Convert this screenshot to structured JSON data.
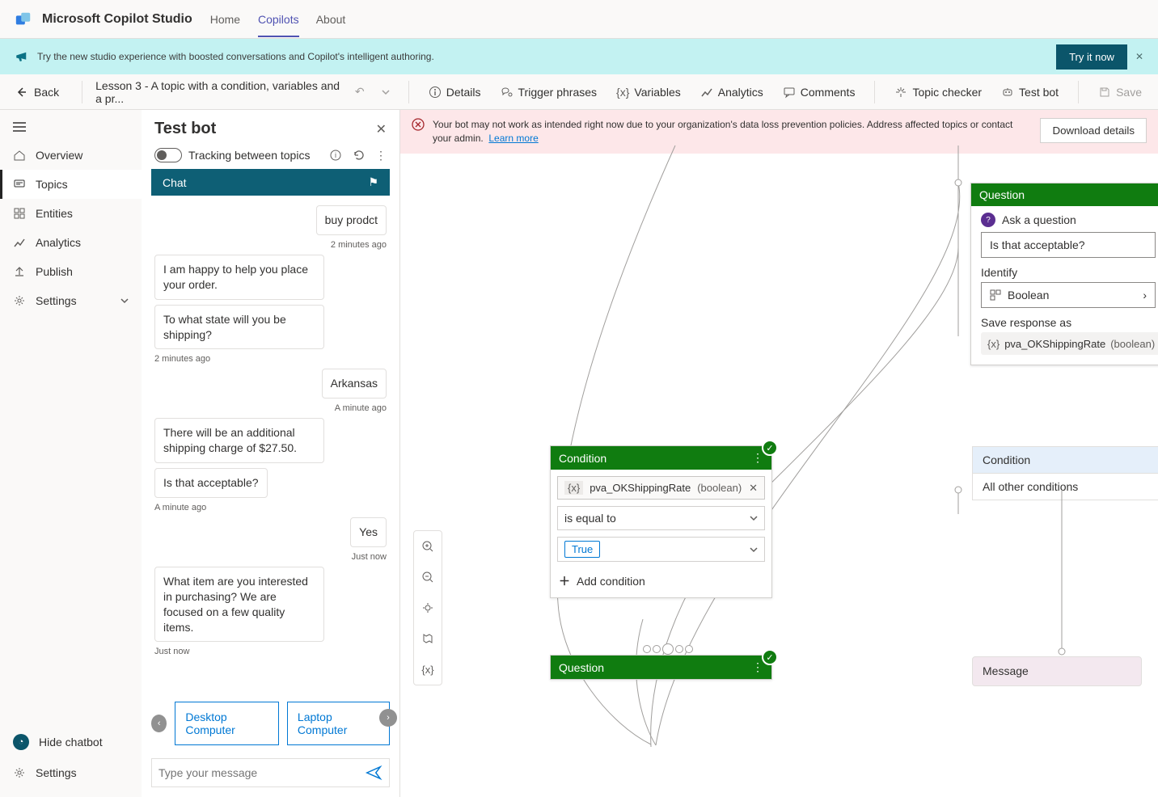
{
  "brand": "Microsoft Copilot Studio",
  "nav": {
    "home": "Home",
    "copilots": "Copilots",
    "about": "About"
  },
  "banner": {
    "text": "Try the new studio experience with boosted conversations and Copilot's intelligent authoring.",
    "try": "Try it now"
  },
  "toolbar": {
    "back": "Back",
    "breadcrumb": "Lesson 3 - A topic with a condition, variables and a pr...",
    "details": "Details",
    "trigger": "Trigger phrases",
    "variables": "Variables",
    "analytics": "Analytics",
    "comments": "Comments",
    "topic_checker": "Topic checker",
    "test_bot": "Test bot",
    "save": "Save"
  },
  "rail": {
    "overview": "Overview",
    "topics": "Topics",
    "entities": "Entities",
    "analytics": "Analytics",
    "publish": "Publish",
    "settings": "Settings",
    "hide": "Hide chatbot",
    "settings2": "Settings"
  },
  "testbot": {
    "title": "Test bot",
    "tracking": "Tracking between topics",
    "chat": "Chat",
    "m1": "buy prodct",
    "t1": "2 minutes ago",
    "m2": "I am happy to help you place your order.",
    "m3": "To what state will you be shipping?",
    "t2": "2 minutes ago",
    "m4": "Arkansas",
    "t3": "A minute ago",
    "m5": "There will be an additional shipping charge of $27.50.",
    "m6": "Is that acceptable?",
    "t4": "A minute ago",
    "m7": "Yes",
    "t5": "Just now",
    "m8": "What item are you interested in purchasing? We are focused on a few quality items.",
    "t6": "Just now",
    "s1": "Desktop Computer",
    "s2": "Laptop Computer",
    "placeholder": "Type your message"
  },
  "alert": {
    "text": "Your bot may not work as intended right now due to your organization's data loss prevention policies. Address affected topics or contact your admin.",
    "link": "Learn more",
    "dl": "Download details"
  },
  "qnode": {
    "hd": "Question",
    "ask": "Ask a question",
    "val": "Is that acceptable?",
    "identify": "Identify",
    "idval": "Boolean",
    "save_as": "Save response as",
    "var": "pva_OKShippingRate",
    "vartype": "(boolean)"
  },
  "cond": {
    "hd": "Condition",
    "var": "pva_OKShippingRate",
    "vartype": "(boolean)",
    "op": "is equal to",
    "val": "True",
    "add": "Add condition"
  },
  "side": {
    "cond": "Condition",
    "all": "All other conditions",
    "msg": "Message"
  },
  "q2": {
    "hd": "Question"
  },
  "zoom": {
    "var": "{x}"
  }
}
